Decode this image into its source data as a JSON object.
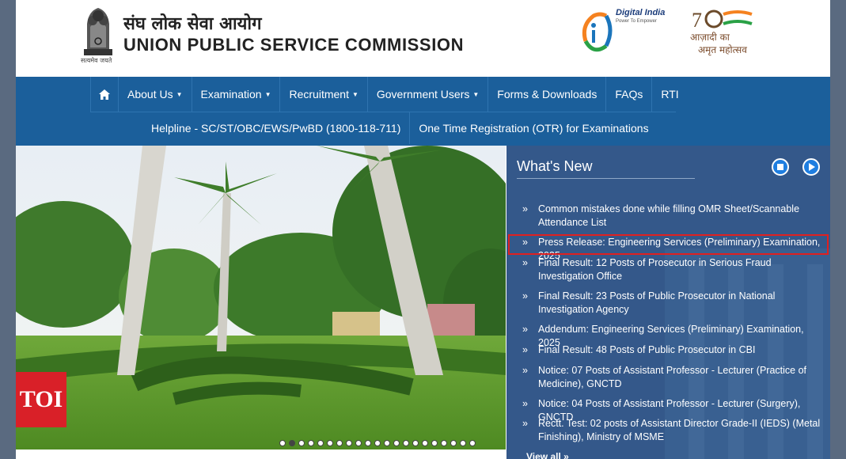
{
  "header": {
    "title_hindi": "संघ लोक सेवा आयोग",
    "title_english": "UNION PUBLIC SERVICE COMMISSION",
    "emblem_motto": "सत्यमेव जयते",
    "digital_india": "Digital India",
    "digital_india_tagline": "Power To Empower",
    "azadi_line1": "आज़ादी का",
    "azadi_line2": "अमृत महोत्सव"
  },
  "nav": {
    "home_icon": "home-icon",
    "items": [
      {
        "label": "About Us",
        "dropdown": true
      },
      {
        "label": "Examination",
        "dropdown": true
      },
      {
        "label": "Recruitment",
        "dropdown": true
      },
      {
        "label": "Government Users",
        "dropdown": true
      },
      {
        "label": "Forms & Downloads",
        "dropdown": false
      },
      {
        "label": "FAQs",
        "dropdown": false
      },
      {
        "label": "RTI",
        "dropdown": false
      }
    ],
    "row2": [
      "Helpline - SC/ST/OBC/EWS/PwBD (1800-118-711)",
      "One Time Registration (OTR) for Examinations"
    ]
  },
  "slider": {
    "dot_count": 21,
    "active_dot": 2
  },
  "watermark": "TOI",
  "whats_new": {
    "title": "What's New",
    "items": [
      "Common mistakes done while filling OMR Sheet/Scannable Attendance List",
      "Press Release: Engineering Services (Preliminary) Examination, 2025",
      "Final Result: 12 Posts of Prosecutor in Serious Fraud Investigation Office",
      "Final Result: 23 Posts of Public Prosecutor in National Investigation Agency",
      "Addendum: Engineering Services (Preliminary) Examination, 2025",
      "Final Result: 48 Posts of Public Prosecutor in CBI",
      "Notice: 07 Posts of Assistant Professor - Lecturer (Practice of Medicine), GNCTD",
      "Notice: 04 Posts of Assistant Professor - Lecturer (Surgery), GNCTD",
      "Rectt. Test: 02 posts of Assistant Director Grade-II (IEDS) (Metal Finishing), Ministry of MSME"
    ],
    "bullet": "»",
    "view_all": "View all »",
    "highlighted_index": 1
  },
  "colors": {
    "nav_bg": "#1b5f9b",
    "news_bg": "#34588a",
    "highlight": "#e02020",
    "toi": "#d92028"
  }
}
